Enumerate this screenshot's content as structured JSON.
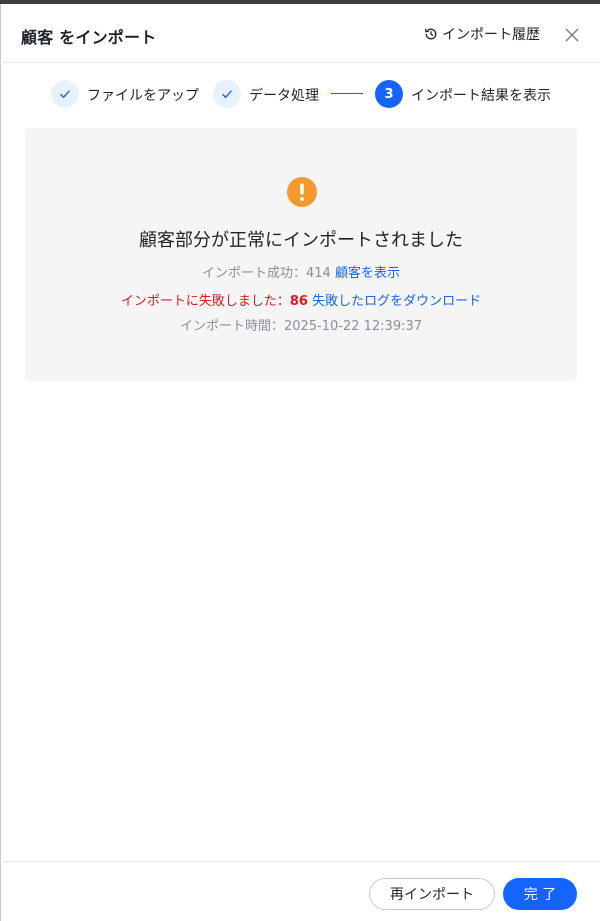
{
  "dialog": {
    "title": "顧客 をインポート",
    "history_label": "インポート履歴"
  },
  "steps": [
    {
      "label": "ファイルをアップ",
      "status": "done"
    },
    {
      "label": "データ処理",
      "status": "done"
    },
    {
      "number": "3",
      "label": "インポート結果を表示",
      "status": "active"
    }
  ],
  "result": {
    "title": "顧客部分が正常にインポートされました",
    "success_text": "インポート成功：414",
    "view_customers_link": "顧客を表示",
    "fail_text": "インポートに失敗しました：",
    "fail_count": "86",
    "download_log_link": "失敗したログをダウンロード",
    "time_text": "インポート時間：2025-10-22 12:39:37"
  },
  "footer": {
    "reimport_label": "再インポート",
    "done_label": "完 了"
  },
  "colors": {
    "primary": "#1664ff",
    "error": "#e5161d",
    "warning": "#f39a2f",
    "panel_bg": "#f5f5f6"
  }
}
